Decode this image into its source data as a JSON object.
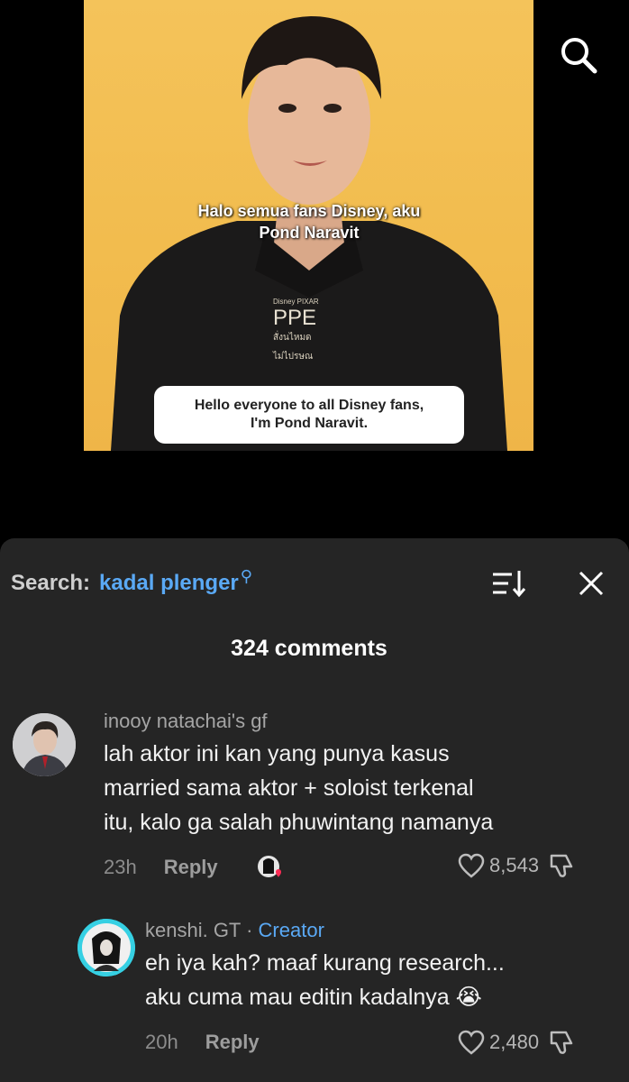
{
  "video": {
    "subtitle_indonesian": [
      "Halo semua fans Disney, aku",
      "Pond Naravit"
    ],
    "subtitle_english": [
      "Hello everyone to all Disney fans,",
      "I'm Pond Naravit."
    ],
    "shirt_print": [
      "Disney PIXAR",
      "PPE",
      "สั่งนไหมด",
      "ไม่ไปรษณ"
    ],
    "search_icon": "search-icon"
  },
  "comments_panel": {
    "search_prefix": "Search:",
    "search_term": "kadal plenger",
    "search_suffix_icon": "magnifier-superscript",
    "sort_icon": "sort-icon",
    "close_icon": "close-icon",
    "count_label": "324 comments",
    "comments": [
      {
        "username": "inooy natachai's gf",
        "text_lines": [
          "lah aktor ini kan yang punya kasus",
          "married sama aktor + soloist terkenal",
          "itu, kalo ga salah phuwintang namanya"
        ],
        "time": "23h",
        "reply_label": "Reply",
        "likes": "8,543",
        "creator_liked": true
      },
      {
        "username": "kenshi. GT",
        "badge_sep": " · ",
        "badge": "Creator",
        "text_lines": [
          "eh iya kah? maaf kurang research...",
          "aku cuma mau editin kadalnya 😭"
        ],
        "time": "20h",
        "reply_label": "Reply",
        "likes": "2,480"
      }
    ]
  },
  "colors": {
    "sheet_bg": "#252525",
    "accent_blue": "#5aa9f5",
    "video_bg": "#f2bc4e"
  }
}
